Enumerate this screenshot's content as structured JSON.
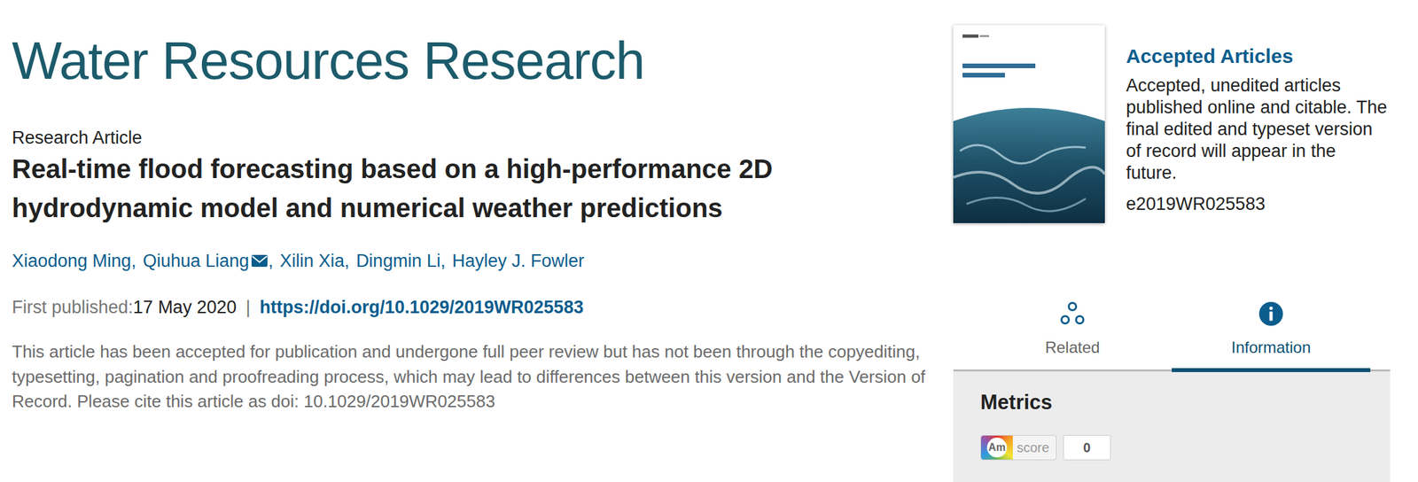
{
  "journal": {
    "title": "Water Resources Research"
  },
  "article": {
    "type": "Research Article",
    "title": "Real-time flood forecasting based on a high-performance 2D hydrodynamic model and numerical weather predictions",
    "authors": [
      {
        "name": "Xiaodong Ming",
        "suffix": ",",
        "corresponding": false
      },
      {
        "name": "Qiuhua Liang",
        "suffix": ",",
        "corresponding": true
      },
      {
        "name": "Xilin Xia",
        "suffix": ",",
        "corresponding": false
      },
      {
        "name": "Dingmin Li",
        "suffix": ",",
        "corresponding": false
      },
      {
        "name": "Hayley J. Fowler",
        "suffix": "",
        "corresponding": false
      }
    ],
    "published_label": "First published:",
    "published_date": "17 May 2020",
    "divider": "|",
    "doi_link": "https://doi.org/10.1029/2019WR025583",
    "notice": "This article has been accepted for publication and undergone full peer review but has not been through the copyediting, typesetting, pagination and proofreading process, which may lead to differences between this version and the Version of Record. Please cite this article as doi: 10.1029/2019WR025583"
  },
  "issue": {
    "heading": "Accepted Articles",
    "description": "Accepted, unedited articles published online and citable. The final edited and typeset version of record will appear in the future.",
    "article_id": "e2019WR025583"
  },
  "tabs": [
    {
      "label": "Related",
      "selected": false
    },
    {
      "label": "Information",
      "selected": true
    }
  ],
  "metrics": {
    "heading": "Metrics",
    "badge_logo": "Am",
    "badge_label": "score",
    "score": "0"
  }
}
